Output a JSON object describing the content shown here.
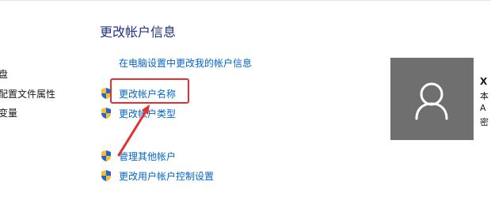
{
  "sidebar": {
    "items": [
      {
        "label": "盘"
      },
      {
        "label": "配置文件属性"
      },
      {
        "label": "变量"
      }
    ]
  },
  "main": {
    "title": "更改帐户信息",
    "settings_link": "在电脑设置中更改我的帐户信息",
    "tasks": [
      {
        "label": "更改帐户名称"
      },
      {
        "label": "更改帐户类型"
      },
      {
        "label": "管理其他帐户"
      },
      {
        "label": "更改用户帐户控制设置"
      }
    ]
  },
  "account": {
    "name_fragment": "X",
    "line1": "本",
    "line2": "A",
    "line3": "密"
  },
  "colors": {
    "link": "#0066cc",
    "title": "#1e3287",
    "highlight": "#e53030",
    "avatar_bg": "#6f6f6f"
  },
  "icons": {
    "task": "uac-shield-icon",
    "avatar": "user-silhouette-icon"
  }
}
